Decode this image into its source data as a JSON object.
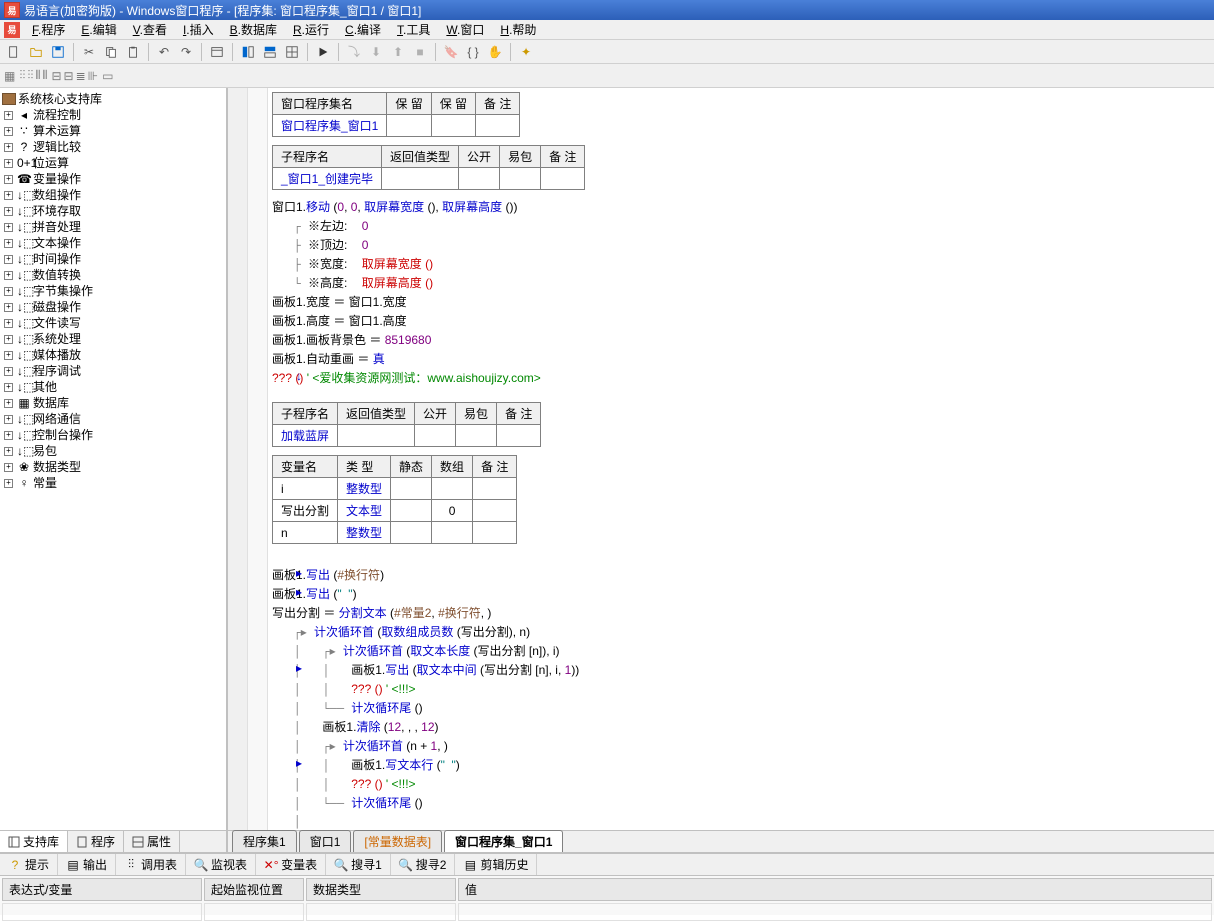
{
  "title": "易语言(加密狗版) - Windows窗口程序 - [程序集: 窗口程序集_窗口1 / 窗口1]",
  "menus": [
    "F.程序",
    "E.编辑",
    "V.查看",
    "I.插入",
    "B.数据库",
    "R.运行",
    "C.编译",
    "T.工具",
    "W.窗口",
    "H.帮助"
  ],
  "tree": {
    "root": "系统核心支持库",
    "items": [
      {
        "icon": "◂",
        "label": "流程控制"
      },
      {
        "icon": "∵",
        "label": "算术运算"
      },
      {
        "icon": "?",
        "label": "逻辑比较"
      },
      {
        "icon": "0+1",
        "label": "位运算"
      },
      {
        "icon": "☎",
        "label": "变量操作"
      },
      {
        "icon": "↓⬚",
        "label": "数组操作"
      },
      {
        "icon": "↓⬚",
        "label": "环境存取"
      },
      {
        "icon": "↓⬚",
        "label": "拼音处理"
      },
      {
        "icon": "↓⬚",
        "label": "文本操作"
      },
      {
        "icon": "↓⬚",
        "label": "时间操作"
      },
      {
        "icon": "↓⬚",
        "label": "数值转换"
      },
      {
        "icon": "↓⬚",
        "label": "字节集操作"
      },
      {
        "icon": "↓⬚",
        "label": "磁盘操作"
      },
      {
        "icon": "↓⬚",
        "label": "文件读写"
      },
      {
        "icon": "↓⬚",
        "label": "系统处理"
      },
      {
        "icon": "↓⬚",
        "label": "媒体播放"
      },
      {
        "icon": "↓⬚",
        "label": "程序调试"
      },
      {
        "icon": "↓⬚",
        "label": "其他"
      },
      {
        "icon": "▦",
        "label": "数据库"
      },
      {
        "icon": "↓⬚",
        "label": "网络通信"
      },
      {
        "icon": "↓⬚",
        "label": "控制台操作"
      },
      {
        "icon": "↓⬚",
        "label": "易包"
      },
      {
        "icon": "❀",
        "label": "数据类型"
      },
      {
        "icon": "♀",
        "label": "常量"
      }
    ]
  },
  "sidebar_tabs": [
    {
      "label": "支持库",
      "active": true
    },
    {
      "label": "程序",
      "active": false
    },
    {
      "label": "属性",
      "active": false
    }
  ],
  "table1": {
    "headers": [
      "窗口程序集名",
      "保 留",
      "保 留",
      "备 注"
    ],
    "rows": [
      [
        "窗口程序集_窗口1",
        "",
        "",
        ""
      ]
    ]
  },
  "table2": {
    "headers": [
      "子程序名",
      "返回值类型",
      "公开",
      "易包",
      "备 注"
    ],
    "rows": [
      [
        "_窗口1_创建完毕",
        "",
        "",
        "",
        ""
      ]
    ]
  },
  "code_block1": {
    "l1": {
      "a": "窗口1.",
      "b": "移动",
      "c": " (",
      "d": "0",
      "e": ", ",
      "f": "0",
      "g": ", ",
      "h": "取屏幕宽度",
      "i": " (), ",
      "j": "取屏幕高度",
      "k": " ())"
    },
    "l2": {
      "a": "※左边:",
      "b": "0"
    },
    "l3": {
      "a": "※顶边:",
      "b": "0"
    },
    "l4": {
      "a": "※宽度:",
      "b": "取屏幕宽度 ()"
    },
    "l5": {
      "a": "※高度:",
      "b": "取屏幕高度 ()"
    },
    "l6": {
      "a": "画板1.宽度 ＝ 窗口1.宽度"
    },
    "l7": {
      "a": "画板1.高度 ＝ 窗口1.高度"
    },
    "l8": {
      "a": "画板1.画板背景色 ＝ ",
      "b": "8519680"
    },
    "l9": {
      "a": "画板1.自动重画 ＝ ",
      "b": "真"
    },
    "l10": {
      "a": "??? () ",
      "b": "' <爱收集资源网测试：www.aishoujizy.com>"
    }
  },
  "table3": {
    "headers": [
      "子程序名",
      "返回值类型",
      "公开",
      "易包",
      "备 注"
    ],
    "rows": [
      [
        "加载蓝屏",
        "",
        "",
        "",
        ""
      ]
    ]
  },
  "table4": {
    "headers": [
      "变量名",
      "类 型",
      "静态",
      "数组",
      "备 注"
    ],
    "rows": [
      [
        "i",
        "整数型",
        "",
        "",
        ""
      ],
      [
        "写出分割",
        "文本型",
        "",
        "0",
        ""
      ],
      [
        "n",
        "整数型",
        "",
        "",
        ""
      ]
    ]
  },
  "code_block2": {
    "l1": {
      "a": "画板1.",
      "b": "写出",
      "c": " (",
      "d": "#换行符",
      "e": ")"
    },
    "l2": {
      "a": "画板1.",
      "b": "写出",
      "c": " (",
      "d": "\"  \"",
      "e": ")"
    },
    "l3": {
      "a": "写出分割 ＝ ",
      "b": "分割文本",
      "c": " (",
      "d": "#常量2",
      "e": ", ",
      "f": "#换行符",
      "g": ", )"
    },
    "l4": {
      "a": "计次循环首",
      "b": " (",
      "c": "取数组成员数",
      "d": " (写出分割), n)"
    },
    "l5": {
      "a": "计次循环首",
      "b": " (",
      "c": "取文本长度",
      "d": " (写出分割 [n]), i)"
    },
    "l6": {
      "a": "画板1.",
      "b": "写出",
      "c": " (",
      "d": "取文本中间",
      "e": " (写出分割 [n], i, ",
      "f": "1",
      "g": "))"
    },
    "l7": {
      "a": "??? () ",
      "b": "' <!!!>"
    },
    "l8": {
      "a": "计次循环尾",
      "b": " ()"
    },
    "l9": {
      "a": "画板1.",
      "b": "清除",
      "c": " (",
      "d": "12",
      "e": ", , , ",
      "f": "12",
      "g": ")"
    },
    "l10": {
      "a": "计次循环首",
      "b": " (n + ",
      "c": "1",
      "d": ", )"
    },
    "l11": {
      "a": "画板1.",
      "b": "写文本行",
      "c": " (",
      "d": "\"  \"",
      "e": ")"
    },
    "l12": {
      "a": "??? () ",
      "b": "' <!!!>"
    },
    "l13": {
      "a": "计次循环尾",
      "b": " ()"
    },
    "l14": {
      "a": "计次循环尾",
      "b": " ()"
    }
  },
  "content_tabs": [
    {
      "label": "程序集1",
      "active": false
    },
    {
      "label": "窗口1",
      "active": false
    },
    {
      "label": "[常量数据表]",
      "active": false,
      "highlight": true
    },
    {
      "label": "窗口程序集_窗口1",
      "active": true
    }
  ],
  "bottom_tabs": [
    "提示",
    "输出",
    "调用表",
    "监视表",
    "变量表",
    "搜寻1",
    "搜寻2",
    "剪辑历史"
  ],
  "watch_headers": [
    "表达式/变量",
    "起始监视位置",
    "数据类型",
    "值"
  ]
}
